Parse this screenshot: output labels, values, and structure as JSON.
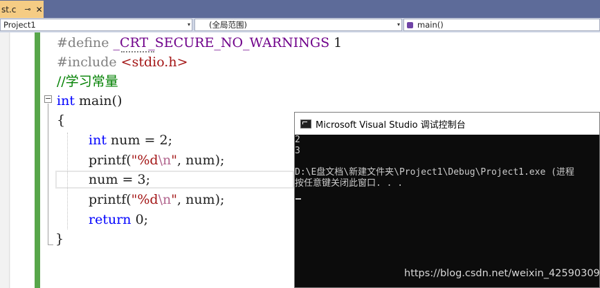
{
  "tab": {
    "label": "st.c",
    "pin_icon": "pin-icon",
    "close_icon": "close-icon",
    "pin": "⊸",
    "close": "✕"
  },
  "nav": {
    "project": "Project1",
    "scope": "(全局范围)",
    "member": "main()",
    "arrow": "▾"
  },
  "code": {
    "define_kw": "#define",
    "define_macro": "_CRT_SECURE_NO_WARNINGS",
    "define_val": " 1",
    "include_kw": "#include",
    "include_hdr": "<stdio.h>",
    "comment": "//学习常量",
    "main_kw": "int",
    "main_rest": " main()",
    "open_brace": "{",
    "l6_kw": "int",
    "l6_rest": " num = 2;",
    "p1_name": "printf(",
    "p1_str_a": "\"%d",
    "p1_esc": "\\n",
    "p1_str_b": "\"",
    "p1_rest": ", num);",
    "l8": "num = 3;",
    "p2_name": "printf(",
    "p2_str_a": "\"%d",
    "p2_esc": "\\n",
    "p2_str_b": "\"",
    "p2_rest": ", num);",
    "ret_kw": "return",
    "ret_rest": " 0;",
    "close_brace": "}",
    "fold_glyph": "−"
  },
  "console": {
    "title": "Microsoft Visual Studio 调试控制台",
    "lines": [
      "2",
      "3",
      "",
      "D:\\E盘文档\\新建文件夹\\Project1\\Debug\\Project1.exe (进程",
      "按任意键关闭此窗口. . ."
    ]
  },
  "watermark": "https://blog.csdn.net/weixin_42590309",
  "colors": {
    "accent_tab": "#f5cc84",
    "tabstrip": "#5d6b99",
    "changebar": "#57a64a",
    "console_bg": "#0c0c0c"
  }
}
